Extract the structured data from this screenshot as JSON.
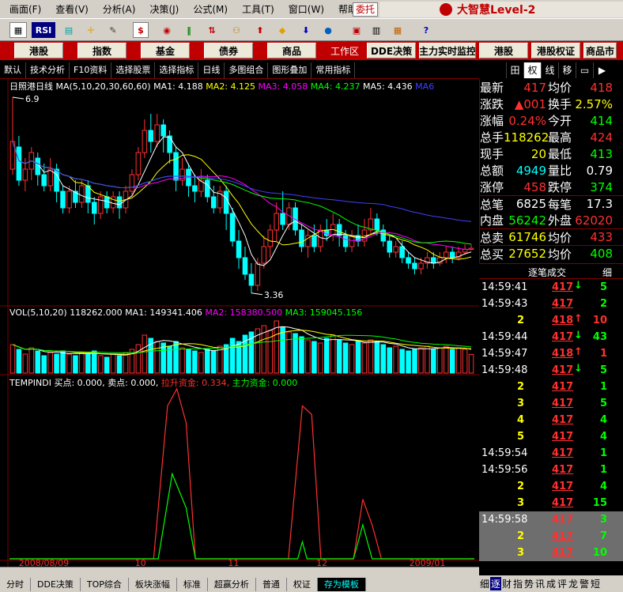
{
  "menu": [
    "画面(F)",
    "查看(V)",
    "分析(A)",
    "决策(J)",
    "公式(M)",
    "工具(T)",
    "窗口(W)",
    "帮助(H)"
  ],
  "entrust_label": "委托",
  "brand": "大智慧Level-2",
  "toolbar_icons": [
    "RSI",
    "$"
  ],
  "nav": {
    "left": [
      "港股",
      "指数",
      "基金",
      "债券",
      "商品"
    ],
    "workarea": "工作区",
    "right": [
      "DDE决策",
      "主力实时监控",
      "港股",
      "港股权证",
      "商品市"
    ]
  },
  "subbar": [
    "默认",
    "技术分析",
    "F10资料",
    "选择股票",
    "选择指标",
    "日线",
    "多图组合",
    "图形叠加",
    "常用指标"
  ],
  "rtabs": [
    "田",
    "权",
    "线",
    "移",
    "",
    ""
  ],
  "main_indicator": {
    "title": "日照港日线",
    "label": "MA(5,10,20,30,60,60)",
    "ma1": "MA1: 4.188",
    "ma2": "MA2: 4.125",
    "ma3": "MA3: 4.058",
    "ma4": "MA4: 4.237",
    "ma5": "MA5: 4.436",
    "ma6": "MA6",
    "high_label": "6.9",
    "low_label": "3.36"
  },
  "vol_indicator": {
    "label": "VOL(5,10,20)",
    "value": "118262.000",
    "ma1": "MA1: 149341.406",
    "ma2": "MA2: 158380.500",
    "ma3": "MA3: 159045.156"
  },
  "temp_indicator": {
    "label": "TEMPINDI",
    "buy": "买点: 0.000,",
    "sell": "卖点: 0.000,",
    "lift": "拉升资金: 0.334,",
    "main": "主力资金: 0.000"
  },
  "x_labels": [
    "2008/08/09",
    "10",
    "11",
    "12",
    "2009/01"
  ],
  "quote": [
    {
      "l1": "最新",
      "v1": "417",
      "c1": "#ff3030",
      "l2": "均价",
      "v2": "418",
      "c2": "#ff3030"
    },
    {
      "l1": "涨跌",
      "v1": "▲001",
      "c1": "#ff3030",
      "l2": "换手",
      "v2": "2.57%",
      "c2": "#ffff00"
    },
    {
      "l1": "涨幅",
      "v1": "0.24%",
      "c1": "#ff3030",
      "l2": "今开",
      "v2": "414",
      "c2": "#00ff00"
    },
    {
      "l1": "总手",
      "v1": "118262",
      "c1": "#ffff00",
      "l2": "最高",
      "v2": "424",
      "c2": "#ff3030"
    },
    {
      "l1": "现手",
      "v1": "20",
      "c1": "#ffff00",
      "l2": "最低",
      "v2": "413",
      "c2": "#00ff00"
    },
    {
      "l1": "总额",
      "v1": "4949",
      "c1": "#00ffff",
      "l2": "量比",
      "v2": "0.79",
      "c2": "#ffffff"
    },
    {
      "l1": "涨停",
      "v1": "458",
      "c1": "#ff3030",
      "l2": "跌停",
      "v2": "374",
      "c2": "#00ff00"
    },
    {
      "l1": "总笔",
      "v1": "6825",
      "c1": "#ffffff",
      "l2": "每笔",
      "v2": "17.3",
      "c2": "#ffffff"
    },
    {
      "l1": "内盘",
      "v1": "56242",
      "c1": "#00ff00",
      "l2": "外盘",
      "v2": "62020",
      "c2": "#ff3030"
    },
    {
      "l1": "总卖",
      "v1": "61746",
      "c1": "#ffff00",
      "l2": "均价",
      "v2": "433",
      "c2": "#ff3030"
    },
    {
      "l1": "总买",
      "v1": "27652",
      "c1": "#ffff00",
      "l2": "均价",
      "v2": "408",
      "c2": "#00ff00"
    }
  ],
  "ticks_header": {
    "title": "逐笔成交",
    "detail": "细"
  },
  "ticks": [
    {
      "t": "14:59:41",
      "p": "417",
      "a": "↓",
      "ac": "#00ff00",
      "q": "5",
      "qc": "#00ff00",
      "hl": false
    },
    {
      "t": "14:59:43",
      "p": "417",
      "a": "",
      "ac": "#00ff00",
      "q": "2",
      "qc": "#00ff00",
      "hl": false
    },
    {
      "t": "",
      "v": "2",
      "p": "418",
      "a": "↑",
      "ac": "#ff3030",
      "q": "10",
      "qc": "#ff3030",
      "hl": false
    },
    {
      "t": "14:59:44",
      "p": "417",
      "a": "↓",
      "ac": "#00ff00",
      "q": "43",
      "qc": "#00ff00",
      "hl": false
    },
    {
      "t": "14:59:47",
      "p": "418",
      "a": "↑",
      "ac": "#ff3030",
      "q": "1",
      "qc": "#ff3030",
      "hl": false
    },
    {
      "t": "14:59:48",
      "p": "417",
      "a": "↓",
      "ac": "#00ff00",
      "q": "5",
      "qc": "#00ff00",
      "hl": false
    },
    {
      "t": "",
      "v": "2",
      "p": "417",
      "a": "",
      "ac": "#00ff00",
      "q": "1",
      "qc": "#00ff00",
      "hl": false
    },
    {
      "t": "",
      "v": "3",
      "p": "417",
      "a": "",
      "ac": "#00ff00",
      "q": "5",
      "qc": "#00ff00",
      "hl": false
    },
    {
      "t": "",
      "v": "4",
      "p": "417",
      "a": "",
      "ac": "#00ff00",
      "q": "4",
      "qc": "#00ff00",
      "hl": false
    },
    {
      "t": "",
      "v": "5",
      "p": "417",
      "a": "",
      "ac": "#00ff00",
      "q": "4",
      "qc": "#00ff00",
      "hl": false
    },
    {
      "t": "14:59:54",
      "p": "417",
      "a": "",
      "ac": "#00ff00",
      "q": "1",
      "qc": "#00ff00",
      "hl": false
    },
    {
      "t": "14:59:56",
      "p": "417",
      "a": "",
      "ac": "#00ff00",
      "q": "1",
      "qc": "#00ff00",
      "hl": false
    },
    {
      "t": "",
      "v": "2",
      "p": "417",
      "a": "",
      "ac": "#00ff00",
      "q": "4",
      "qc": "#00ff00",
      "hl": false
    },
    {
      "t": "",
      "v": "3",
      "p": "417",
      "a": "",
      "ac": "#00ff00",
      "q": "15",
      "qc": "#00ff00",
      "hl": false
    },
    {
      "t": "14:59:58",
      "p": "417",
      "a": "",
      "ac": "#00ff00",
      "q": "3",
      "qc": "#00ff00",
      "hl": true
    },
    {
      "t": "",
      "v": "2",
      "p": "417",
      "a": "",
      "ac": "#00ff00",
      "q": "7",
      "qc": "#00ff00",
      "hl": true
    },
    {
      "t": "",
      "v": "3",
      "p": "417",
      "a": "",
      "ac": "#00ff00",
      "q": "10",
      "qc": "#00ff00",
      "hl": true
    }
  ],
  "bottom_tabs": [
    "分时",
    "DDE决策",
    "TOP综合",
    "板块涨幅",
    "标准",
    "超赢分析",
    "普通",
    "权证",
    "存为模板"
  ],
  "bottom_active": 8,
  "rbottom": [
    "细",
    "逐",
    "财",
    "指",
    "势",
    "讯",
    "成",
    "评",
    "龙",
    "警",
    "短"
  ],
  "rbottom_active": 1,
  "colors": {
    "up": "#ff3030",
    "down": "#00ffff",
    "ma1": "#ffffff",
    "ma2": "#ffff00",
    "ma3": "#ff00ff",
    "ma4": "#00ff00",
    "ma5": "#4040ff"
  },
  "chart_data": {
    "type": "candlestick",
    "price_range": [
      3.2,
      7.0
    ],
    "high_marker": 6.9,
    "low_marker": 3.36,
    "candles": [
      [
        5.6,
        6.1,
        6.9,
        5.5
      ],
      [
        6.0,
        5.4,
        6.2,
        5.3
      ],
      [
        5.4,
        5.6,
        5.8,
        5.2
      ],
      [
        5.6,
        5.9,
        6.0,
        5.4
      ],
      [
        5.8,
        5.5,
        5.9,
        5.3
      ],
      [
        5.5,
        5.3,
        5.7,
        5.2
      ],
      [
        5.3,
        5.6,
        5.8,
        5.2
      ],
      [
        5.6,
        5.2,
        5.7,
        5.0
      ],
      [
        5.2,
        4.9,
        5.3,
        4.8
      ],
      [
        4.9,
        5.2,
        5.3,
        4.8
      ],
      [
        5.2,
        5.0,
        5.4,
        4.9
      ],
      [
        5.0,
        5.3,
        5.4,
        4.9
      ],
      [
        5.3,
        5.0,
        5.4,
        4.8
      ],
      [
        5.0,
        4.8,
        5.1,
        4.6
      ],
      [
        4.8,
        5.1,
        5.2,
        4.7
      ],
      [
        5.1,
        4.9,
        5.2,
        4.8
      ],
      [
        4.9,
        5.1,
        5.2,
        4.8
      ],
      [
        5.1,
        4.9,
        5.2,
        4.7
      ],
      [
        4.9,
        5.2,
        5.3,
        4.8
      ],
      [
        5.2,
        5.5,
        5.6,
        5.1
      ],
      [
        5.5,
        5.9,
        6.0,
        5.4
      ],
      [
        5.9,
        6.3,
        6.5,
        5.8
      ],
      [
        6.3,
        6.1,
        6.6,
        5.9
      ],
      [
        6.1,
        6.4,
        6.6,
        6.0
      ],
      [
        6.4,
        6.2,
        6.5,
        5.9
      ],
      [
        6.2,
        5.9,
        6.3,
        5.7
      ],
      [
        5.9,
        5.4,
        6.0,
        5.2
      ],
      [
        5.4,
        5.6,
        5.8,
        5.3
      ],
      [
        5.6,
        5.3,
        5.7,
        5.1
      ],
      [
        5.3,
        5.2,
        5.5,
        5.0
      ],
      [
        5.2,
        5.4,
        5.6,
        5.1
      ],
      [
        5.4,
        5.1,
        5.5,
        5.0
      ],
      [
        5.1,
        4.9,
        5.3,
        4.8
      ],
      [
        4.9,
        5.2,
        5.3,
        4.8
      ],
      [
        5.2,
        4.8,
        5.3,
        4.5
      ],
      [
        4.8,
        4.3,
        4.9,
        4.2
      ],
      [
        4.3,
        4.0,
        4.5,
        3.8
      ],
      [
        4.0,
        3.7,
        4.2,
        3.6
      ],
      [
        3.7,
        3.5,
        3.9,
        3.36
      ],
      [
        3.5,
        3.9,
        4.0,
        3.4
      ],
      [
        3.9,
        4.2,
        4.4,
        3.8
      ],
      [
        4.2,
        4.5,
        4.6,
        4.0
      ],
      [
        4.5,
        4.8,
        5.0,
        4.3
      ],
      [
        4.8,
        4.6,
        5.2,
        4.5
      ],
      [
        4.6,
        4.9,
        5.0,
        4.5
      ],
      [
        4.9,
        4.5,
        5.0,
        4.4
      ],
      [
        4.5,
        4.2,
        4.6,
        4.1
      ],
      [
        4.2,
        4.4,
        4.5,
        4.0
      ],
      [
        4.4,
        4.2,
        4.6,
        4.1
      ],
      [
        4.2,
        4.5,
        4.6,
        4.1
      ],
      [
        4.5,
        4.4,
        4.7,
        4.3
      ],
      [
        4.4,
        4.6,
        4.8,
        4.3
      ],
      [
        4.6,
        4.4,
        4.7,
        4.2
      ],
      [
        4.4,
        4.2,
        4.5,
        4.1
      ],
      [
        4.2,
        4.4,
        4.5,
        4.1
      ],
      [
        4.4,
        4.3,
        4.6,
        4.2
      ],
      [
        4.3,
        4.5,
        4.7,
        4.2
      ],
      [
        4.5,
        4.7,
        4.9,
        4.4
      ],
      [
        4.7,
        4.5,
        4.8,
        4.4
      ],
      [
        4.5,
        4.3,
        4.6,
        4.2
      ],
      [
        4.3,
        4.1,
        4.4,
        4.0
      ],
      [
        4.1,
        4.2,
        4.3,
        4.0
      ],
      [
        4.2,
        4.0,
        4.3,
        3.9
      ],
      [
        4.0,
        3.9,
        4.1,
        3.8
      ],
      [
        3.9,
        3.8,
        4.0,
        3.7
      ],
      [
        3.8,
        3.9,
        4.0,
        3.7
      ],
      [
        3.9,
        4.0,
        4.1,
        3.8
      ],
      [
        4.0,
        3.9,
        4.1,
        3.8
      ],
      [
        3.9,
        4.0,
        4.1,
        3.85
      ],
      [
        4.0,
        4.1,
        4.2,
        3.9
      ],
      [
        4.1,
        4.0,
        4.2,
        3.9
      ],
      [
        4.0,
        4.1,
        4.2,
        3.95
      ],
      [
        4.1,
        4.15,
        4.24,
        4.05
      ],
      [
        4.15,
        4.17,
        4.24,
        4.13
      ]
    ],
    "vol_range": [
      0,
      350000
    ],
    "volumes": [
      180000,
      150000,
      120000,
      160000,
      140000,
      110000,
      130000,
      120000,
      140000,
      120000,
      110000,
      130000,
      120000,
      140000,
      110000,
      100000,
      120000,
      110000,
      130000,
      150000,
      180000,
      240000,
      220000,
      200000,
      190000,
      170000,
      200000,
      160000,
      150000,
      140000,
      130000,
      150000,
      140000,
      170000,
      180000,
      220000,
      200000,
      240000,
      260000,
      280000,
      300000,
      270000,
      330000,
      290000,
      260000,
      250000,
      230000,
      210000,
      200000,
      190000,
      220000,
      240000,
      210000,
      190000,
      180000,
      200000,
      190000,
      210000,
      200000,
      180000,
      160000,
      170000,
      150000,
      140000,
      150000,
      160000,
      170000,
      150000,
      160000,
      170000,
      150000,
      160000,
      150000,
      118262
    ],
    "temp": {
      "lift": [
        [
          0.0,
          0.0
        ],
        [
          0.31,
          0.0
        ],
        [
          0.34,
          0.9
        ],
        [
          0.36,
          1.0
        ],
        [
          0.38,
          0.8
        ],
        [
          0.4,
          0.0
        ],
        [
          0.6,
          0.0
        ],
        [
          0.63,
          0.9
        ],
        [
          0.65,
          0.85
        ],
        [
          0.67,
          0.0
        ],
        [
          0.74,
          0.0
        ],
        [
          0.76,
          0.35
        ],
        [
          0.78,
          0.2
        ],
        [
          0.8,
          0.0
        ],
        [
          1.0,
          0.0
        ]
      ],
      "main": [
        [
          0.0,
          0.0
        ],
        [
          0.32,
          0.0
        ],
        [
          0.35,
          0.5
        ],
        [
          0.38,
          0.3
        ],
        [
          0.4,
          0.0
        ],
        [
          0.62,
          0.0
        ],
        [
          0.63,
          0.1
        ],
        [
          0.64,
          0.0
        ],
        [
          0.74,
          0.0
        ],
        [
          0.76,
          0.2
        ],
        [
          0.78,
          0.0
        ],
        [
          1.0,
          0.0
        ]
      ]
    }
  }
}
